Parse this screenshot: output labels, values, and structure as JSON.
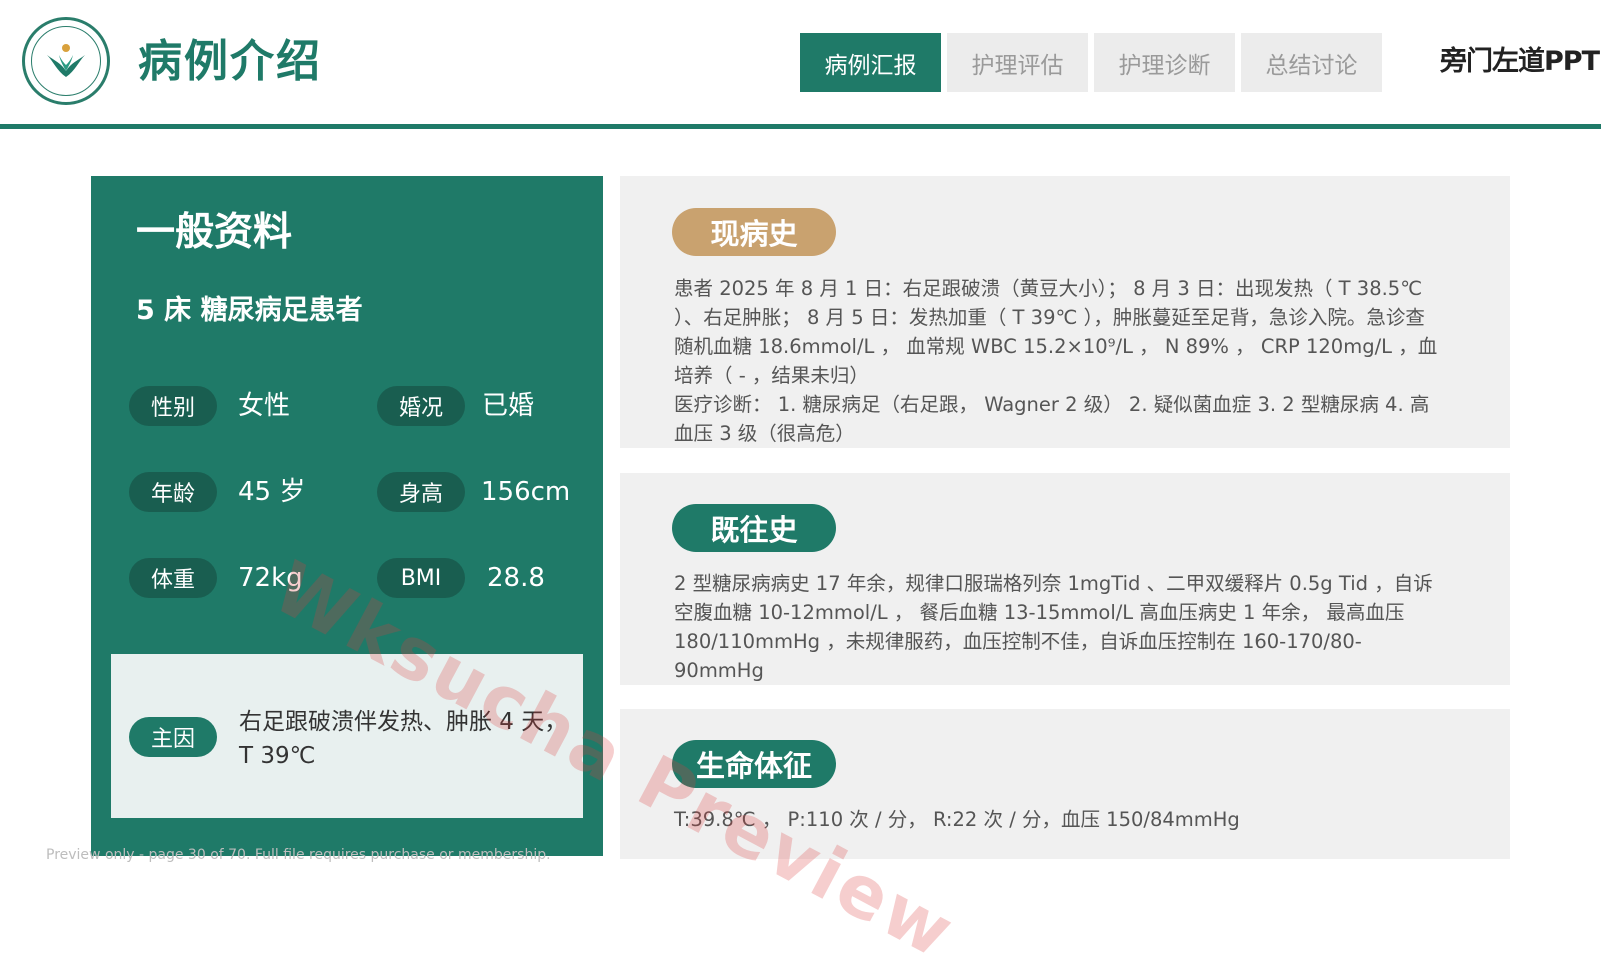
{
  "header": {
    "title": "病例介绍",
    "tabs": [
      {
        "label": "病例汇报",
        "active": true
      },
      {
        "label": "护理评估",
        "active": false
      },
      {
        "label": "护理诊断",
        "active": false
      },
      {
        "label": "总结讨论",
        "active": false
      }
    ],
    "brand": "旁门左道PPT",
    "logo_icon": "hospital-emblem-icon"
  },
  "general": {
    "title": "一般资料",
    "subtitle": "5 床 糖尿病足患者",
    "fields": {
      "gender_label": "性别",
      "gender_value": "女性",
      "marital_label": "婚况",
      "marital_value": "已婚",
      "age_label": "年龄",
      "age_value": "45 岁",
      "height_label": "身高",
      "height_value": "156cm",
      "weight_label": "体重",
      "weight_value": "72kg",
      "bmi_label": "BMI",
      "bmi_value": "28.8"
    },
    "chief": {
      "label": "主因",
      "text": "右足跟破溃伴发热、肿胀 4 天，T 39℃"
    }
  },
  "sections": {
    "present_history": {
      "title": "现病史",
      "lines": [
        "患者 2025 年 8 月 1 日：右足跟破溃（黄豆大小）； 8 月 3 日：出现发热（ T 38.5℃ ）、右足肿胀； 8 月 5 日：发热加重（ T 39℃ ），肿胀蔓延至足背，急诊入院。急诊查随机血糖 18.6mmol/L ， 血常规 WBC 15.2×10⁹/L ， N 89% ， CRP 120mg/L ，血培养（ - ，结果未归）",
        "医疗诊断： 1. 糖尿病足（右足跟， Wagner 2 级） 2. 疑似菌血症 3. 2 型糖尿病 4. 高血压 3 级（很高危）"
      ]
    },
    "past_history": {
      "title": "既往史",
      "text": "2 型糖尿病病史 17 年余，规律口服瑞格列奈 1mgTid 、二甲双缓释片 0.5g Tid ，自诉空腹血糖 10-12mmol/L ， 餐后血糖 13-15mmol/L 高血压病史 1 年余， 最高血压 180/110mmHg ，未规律服药，血压控制不佳，自诉血压控制在 160-170/80-90mmHg"
    },
    "vitals": {
      "title": "生命体征",
      "text": "T:39.8℃ ， P:110 次 / 分， R:22 次 / 分，血压 150/84mmHg"
    }
  },
  "watermark": "Wksucha Preview",
  "footer": "Preview only - page 30 of 70. Full file requires purchase or membership.",
  "colors": {
    "primary": "#1f7a68",
    "dark_pill": "#195e50",
    "gold": "#c9a26f",
    "panel": "#f0f0f0"
  }
}
